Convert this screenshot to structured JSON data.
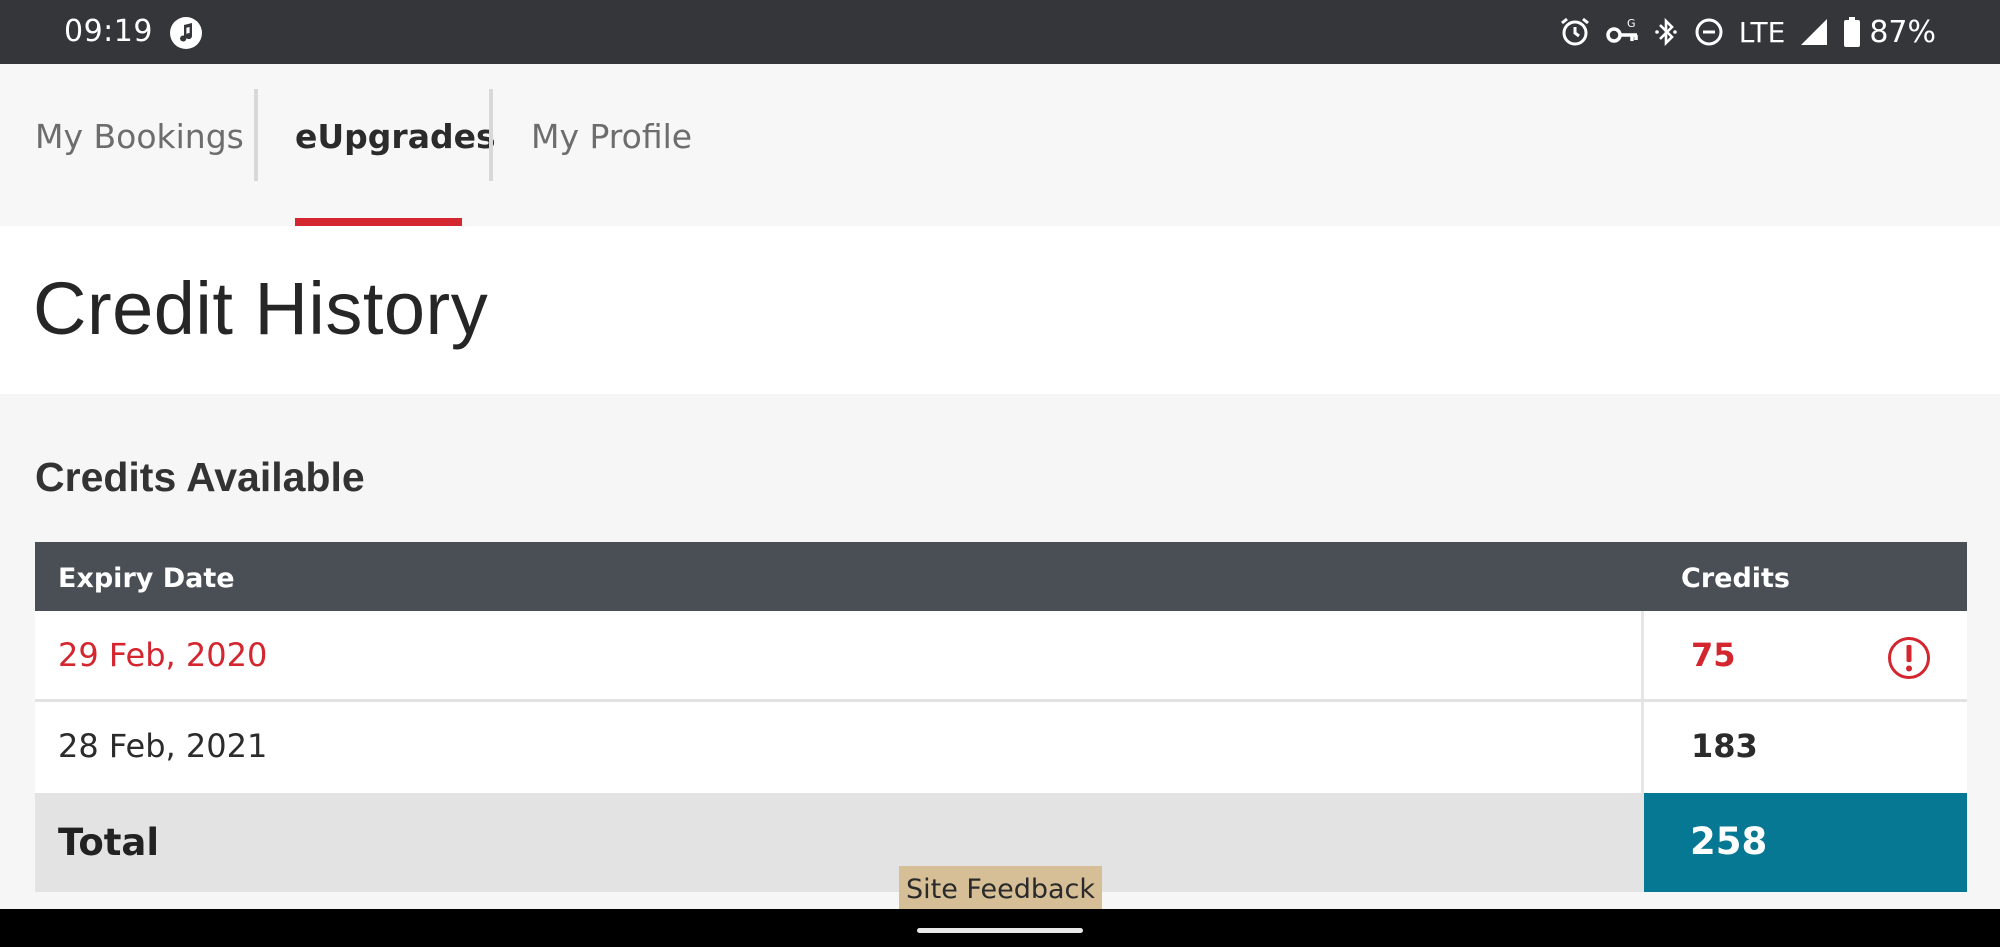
{
  "status_bar": {
    "time": "09:19",
    "network": "LTE",
    "battery": "87%",
    "icons": [
      "music-note-icon",
      "alarm-icon",
      "vpn-key-icon",
      "bluetooth-icon",
      "do-not-disturb-icon",
      "signal-icon",
      "battery-icon"
    ]
  },
  "tabs": [
    {
      "label": "My Bookings",
      "active": false
    },
    {
      "label": "eUpgrades",
      "active": true
    },
    {
      "label": "My Profile",
      "active": false
    }
  ],
  "page": {
    "title": "Credit History",
    "section_heading": "Credits Available"
  },
  "table": {
    "headers": {
      "expiry": "Expiry Date",
      "credits": "Credits"
    },
    "rows": [
      {
        "expiry": "29 Feb, 2020",
        "credits": "75",
        "warning": true
      },
      {
        "expiry": "28 Feb, 2021",
        "credits": "183",
        "warning": false
      }
    ],
    "total": {
      "label": "Total",
      "value": "258"
    }
  },
  "feedback": {
    "label": "Site Feedback"
  },
  "colors": {
    "accent_red": "#d3262f",
    "total_teal": "#067893",
    "header_dark": "#4a4e55",
    "feedback_tan": "#d6bf97"
  }
}
